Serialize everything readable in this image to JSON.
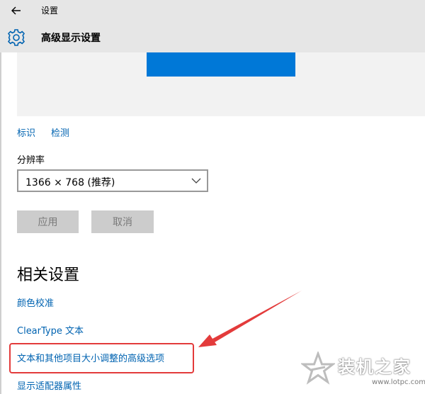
{
  "window": {
    "title": "设置"
  },
  "header": {
    "title": "高级显示设置"
  },
  "display": {
    "identify_label": "标识",
    "detect_label": "检测",
    "resolution_label": "分辨率",
    "resolution_value": "1366 × 768 (推荐)"
  },
  "buttons": {
    "apply": "应用",
    "cancel": "取消"
  },
  "related": {
    "title": "相关设置",
    "links": [
      "颜色校准",
      "ClearType 文本",
      "文本和其他项目大小调整的高级选项",
      "显示适配器属性"
    ]
  },
  "watermark": {
    "brand": "装机之家",
    "url": "www.lotpc.com"
  },
  "colors": {
    "accent": "#0078d7",
    "link": "#0063b1",
    "highlight": "#e33b3b"
  },
  "icons": {
    "back": "back-arrow-icon",
    "settings": "gear-icon",
    "dropdown": "chevron-down-icon"
  }
}
